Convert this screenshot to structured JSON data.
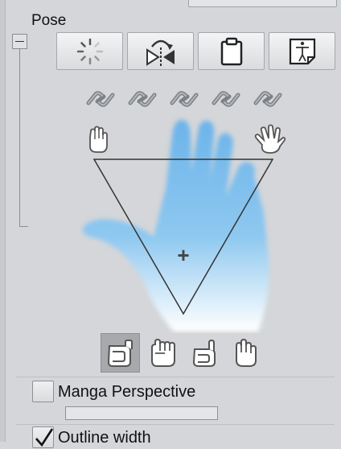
{
  "panel": {
    "title": "Pose"
  },
  "toolbar": {
    "buttons": [
      {
        "icon": "reset-pose-icon"
      },
      {
        "icon": "flip-horizontal-icon"
      },
      {
        "icon": "paste-pose-icon"
      },
      {
        "icon": "register-pose-material-icon"
      }
    ]
  },
  "finger_links": {
    "count": 5,
    "icon": "chain-link-icon"
  },
  "hand_controller": {
    "open_icon": "open-hand-icon",
    "spread_icon": "spread-hand-icon",
    "center_marker": "+"
  },
  "hand_presets": [
    {
      "icon": "fist-thumb-side-icon",
      "selected": true
    },
    {
      "icon": "fist-knuckles-icon",
      "selected": false
    },
    {
      "icon": "fist-thumb-up-icon",
      "selected": false
    },
    {
      "icon": "fist-back-icon",
      "selected": false
    }
  ],
  "settings": {
    "manga_perspective": {
      "label": "Manga Perspective",
      "checked": false
    },
    "outline_width": {
      "label": "Outline width",
      "checked": true
    }
  }
}
